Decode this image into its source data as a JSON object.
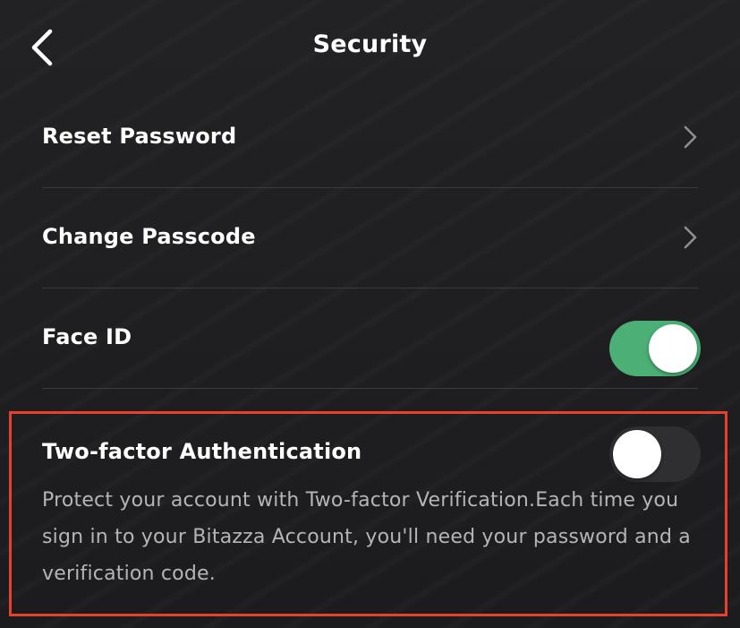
{
  "header": {
    "title": "Security",
    "back_icon": "chevron-left-icon"
  },
  "rows": [
    {
      "label": "Reset Password",
      "control": "chevron-right-icon"
    },
    {
      "label": "Change Passcode",
      "control": "chevron-right-icon"
    },
    {
      "label": "Face ID",
      "control": "toggle",
      "enabled": true
    }
  ],
  "two_factor": {
    "title": "Two-factor Authentication",
    "enabled": false,
    "description": "Protect your account with Two-factor Verification.Each time you sign in to your Bitazza Account, you'll need your password and a verification code.",
    "highlight_color": "#e5412c"
  },
  "colors": {
    "background": "#1e1e20",
    "toggle_on": "#4caf76",
    "toggle_off": "#2f2f31",
    "text_primary": "#ffffff",
    "text_secondary": "#b5b5b8"
  }
}
